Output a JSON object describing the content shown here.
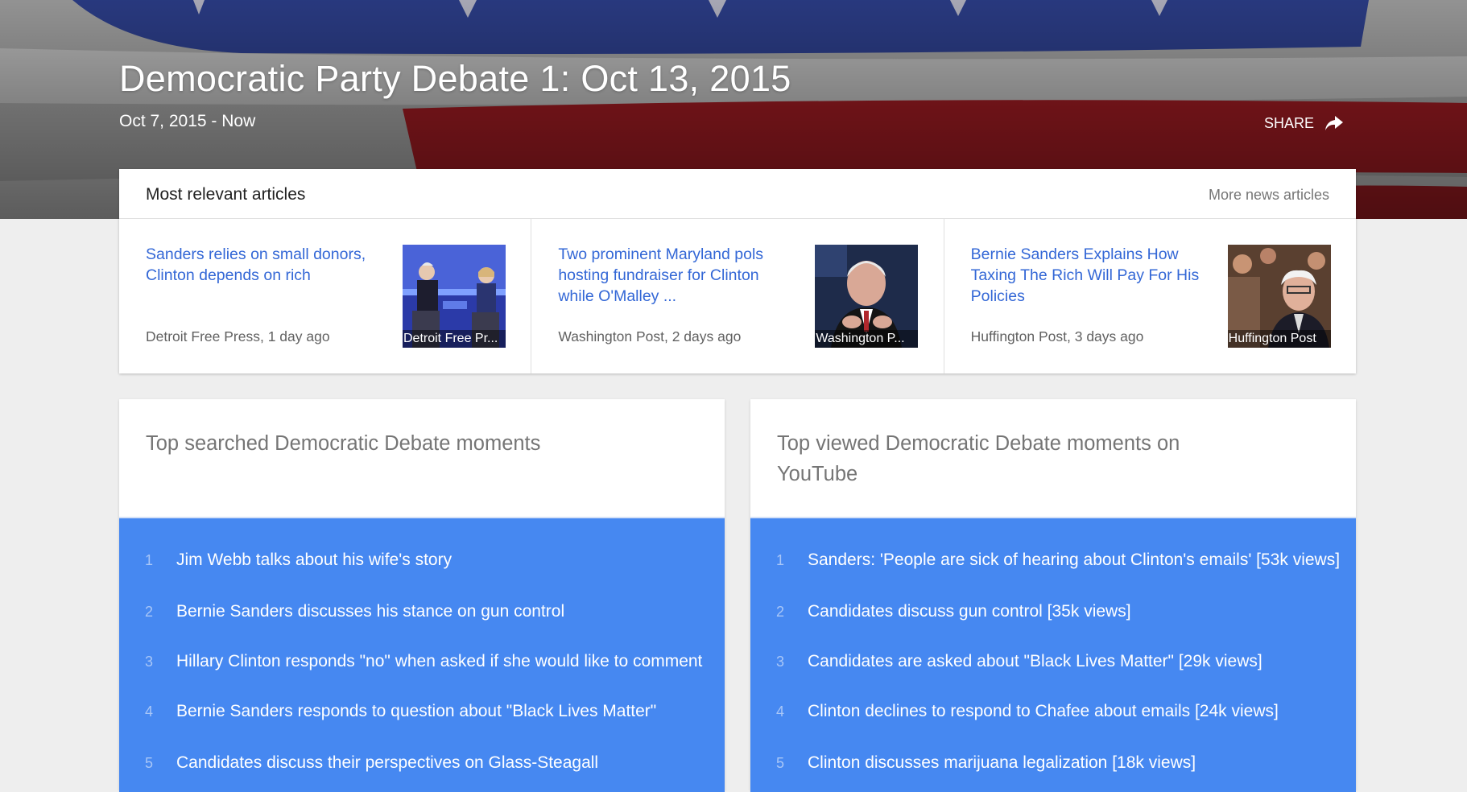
{
  "hero": {
    "title": "Democratic Party Debate 1: Oct 13, 2015",
    "date_range": "Oct 7, 2015 - Now",
    "share_label": "SHARE"
  },
  "relevant": {
    "title": "Most relevant articles",
    "more_label": "More news articles",
    "articles": [
      {
        "headline": "Sanders relies on small donors, Clinton depends on rich",
        "source": "Detroit Free Press, 1 day ago",
        "thumb_caption": "Detroit Free Pr..."
      },
      {
        "headline": "Two prominent Maryland pols hosting fundraiser for Clinton while O'Malley ...",
        "source": "Washington Post, 2 days ago",
        "thumb_caption": "Washington P..."
      },
      {
        "headline": "Bernie Sanders Explains How Taxing The Rich Will Pay For His Policies",
        "source": "Huffington Post, 3 days ago",
        "thumb_caption": "Huffington Post"
      }
    ]
  },
  "searched": {
    "title": "Top searched Democratic Debate moments",
    "items": [
      {
        "num": "1",
        "text": "Jim Webb talks about his wife's story"
      },
      {
        "num": "2",
        "text": "Bernie Sanders discusses his stance on gun control"
      },
      {
        "num": "3",
        "text": "Hillary Clinton responds \"no\" when asked if she would like to comment"
      },
      {
        "num": "4",
        "text": "Bernie Sanders responds to question about \"Black Lives Matter\""
      },
      {
        "num": "5",
        "text": "Candidates discuss their perspectives on Glass-Steagall"
      }
    ]
  },
  "viewed": {
    "title": "Top viewed Democratic Debate moments on YouTube",
    "items": [
      {
        "num": "1",
        "text": "Sanders: 'People are sick of hearing about Clinton's emails' [53k views]"
      },
      {
        "num": "2",
        "text": "Candidates discuss gun control [35k views]"
      },
      {
        "num": "3",
        "text": "Candidates are asked about \"Black Lives Matter\" [29k views]"
      },
      {
        "num": "4",
        "text": "Clinton declines to respond to Chafee about emails [24k views]"
      },
      {
        "num": "5",
        "text": "Clinton discusses marijuana legalization [18k views]"
      }
    ]
  },
  "colors": {
    "link_blue": "#3367d6",
    "list_blue": "#4688f1",
    "flag_blue": "#2d3f8c",
    "flag_red": "#9e1b22"
  }
}
